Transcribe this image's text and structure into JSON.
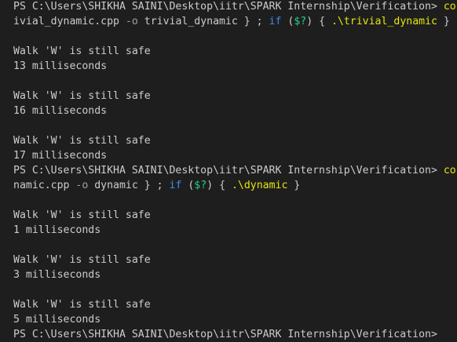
{
  "colors": {
    "background": "#1e1e1e",
    "text": "#cccccc",
    "command": "#e5e510",
    "flag": "#a0a0a0",
    "keyword": "#3b8eea",
    "variable": "#23d18b"
  },
  "lines": [
    {
      "type": "prompt",
      "segments": [
        {
          "text": "PS C:\\Users\\SHIKHA SAINI\\Desktop\\iitr\\SPARK Internship\\Verification> ",
          "style": "plain"
        },
        {
          "text": "co",
          "style": "cmd"
        }
      ]
    },
    {
      "type": "command",
      "segments": [
        {
          "text": "ivial_dynamic.cpp ",
          "style": "plain"
        },
        {
          "text": "-o",
          "style": "flag"
        },
        {
          "text": " trivial_dynamic } ; ",
          "style": "plain"
        },
        {
          "text": "if",
          "style": "kw"
        },
        {
          "text": " (",
          "style": "plain"
        },
        {
          "text": "$?",
          "style": "var"
        },
        {
          "text": ") { ",
          "style": "plain"
        },
        {
          "text": ".\\trivial_dynamic",
          "style": "cmd"
        },
        {
          "text": " }",
          "style": "plain"
        }
      ]
    },
    {
      "type": "blank",
      "segments": []
    },
    {
      "type": "output",
      "segments": [
        {
          "text": "Walk 'W' is still safe",
          "style": "plain"
        }
      ]
    },
    {
      "type": "output",
      "segments": [
        {
          "text": "13 milliseconds",
          "style": "plain"
        }
      ]
    },
    {
      "type": "blank",
      "segments": []
    },
    {
      "type": "output",
      "segments": [
        {
          "text": "Walk 'W' is still safe",
          "style": "plain"
        }
      ]
    },
    {
      "type": "output",
      "segments": [
        {
          "text": "16 milliseconds",
          "style": "plain"
        }
      ]
    },
    {
      "type": "blank",
      "segments": []
    },
    {
      "type": "output",
      "segments": [
        {
          "text": "Walk 'W' is still safe",
          "style": "plain"
        }
      ]
    },
    {
      "type": "output",
      "segments": [
        {
          "text": "17 milliseconds",
          "style": "plain"
        }
      ]
    },
    {
      "type": "prompt",
      "segments": [
        {
          "text": "PS C:\\Users\\SHIKHA SAINI\\Desktop\\iitr\\SPARK Internship\\Verification> ",
          "style": "plain"
        },
        {
          "text": "co",
          "style": "cmd"
        }
      ]
    },
    {
      "type": "command",
      "segments": [
        {
          "text": "namic.cpp ",
          "style": "plain"
        },
        {
          "text": "-o",
          "style": "flag"
        },
        {
          "text": " dynamic } ; ",
          "style": "plain"
        },
        {
          "text": "if",
          "style": "kw"
        },
        {
          "text": " (",
          "style": "plain"
        },
        {
          "text": "$?",
          "style": "var"
        },
        {
          "text": ") { ",
          "style": "plain"
        },
        {
          "text": ".\\dynamic",
          "style": "cmd"
        },
        {
          "text": " }",
          "style": "plain"
        }
      ]
    },
    {
      "type": "blank",
      "segments": []
    },
    {
      "type": "output",
      "segments": [
        {
          "text": "Walk 'W' is still safe",
          "style": "plain"
        }
      ]
    },
    {
      "type": "output",
      "segments": [
        {
          "text": "1 milliseconds",
          "style": "plain"
        }
      ]
    },
    {
      "type": "blank",
      "segments": []
    },
    {
      "type": "output",
      "segments": [
        {
          "text": "Walk 'W' is still safe",
          "style": "plain"
        }
      ]
    },
    {
      "type": "output",
      "segments": [
        {
          "text": "3 milliseconds",
          "style": "plain"
        }
      ]
    },
    {
      "type": "blank",
      "segments": []
    },
    {
      "type": "output",
      "segments": [
        {
          "text": "Walk 'W' is still safe",
          "style": "plain"
        }
      ]
    },
    {
      "type": "output",
      "segments": [
        {
          "text": "5 milliseconds",
          "style": "plain"
        }
      ]
    },
    {
      "type": "prompt",
      "segments": [
        {
          "text": "PS C:\\Users\\SHIKHA SAINI\\Desktop\\iitr\\SPARK Internship\\Verification> ",
          "style": "plain"
        }
      ]
    }
  ]
}
